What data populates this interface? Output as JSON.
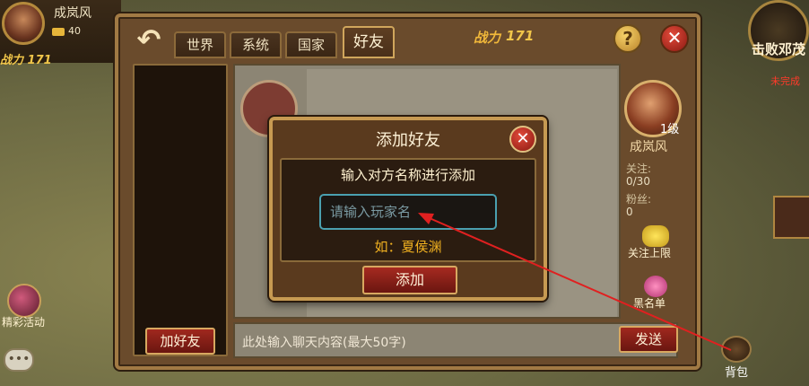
{
  "hud": {
    "player_name": "成岚风",
    "gold": "40",
    "power_prefix": "战力",
    "power": "171",
    "quest_title": "击败邓茂",
    "quest_status": "未完成",
    "event_label": "精彩活动",
    "bag_label": "背包"
  },
  "panel": {
    "tabs": [
      {
        "label": "世界"
      },
      {
        "label": "系统"
      },
      {
        "label": "国家"
      },
      {
        "label": "好友"
      }
    ],
    "power_label": "战力",
    "power_value": "171",
    "help_glyph": "?",
    "close_glyph": "✕",
    "back_glyph": "↶",
    "add_friend_label": "加好友",
    "chat_placeholder": "此处输入聊天内容(最大50字)",
    "send_label": "发送",
    "profile": {
      "level": "1级",
      "name": "成岚风",
      "follow_label": "关注:",
      "follow_value": "0/30",
      "fans_label": "粉丝:",
      "fans_value": "0",
      "limit_label": "关注上限",
      "blacklist_label": "黑名单"
    }
  },
  "dialog": {
    "title": "添加好友",
    "prompt": "输入对方名称进行添加",
    "input_placeholder": "请输入玩家名",
    "input_value": "",
    "hint": "如：夏侯渊",
    "add_label": "添加",
    "close_glyph": "✕"
  },
  "colors": {
    "accent_gold": "#c79a52",
    "button_red": "#a0281e",
    "hint_orange": "#f0b020",
    "input_border": "#4aa0b0",
    "annotation_arrow": "#e02020"
  }
}
